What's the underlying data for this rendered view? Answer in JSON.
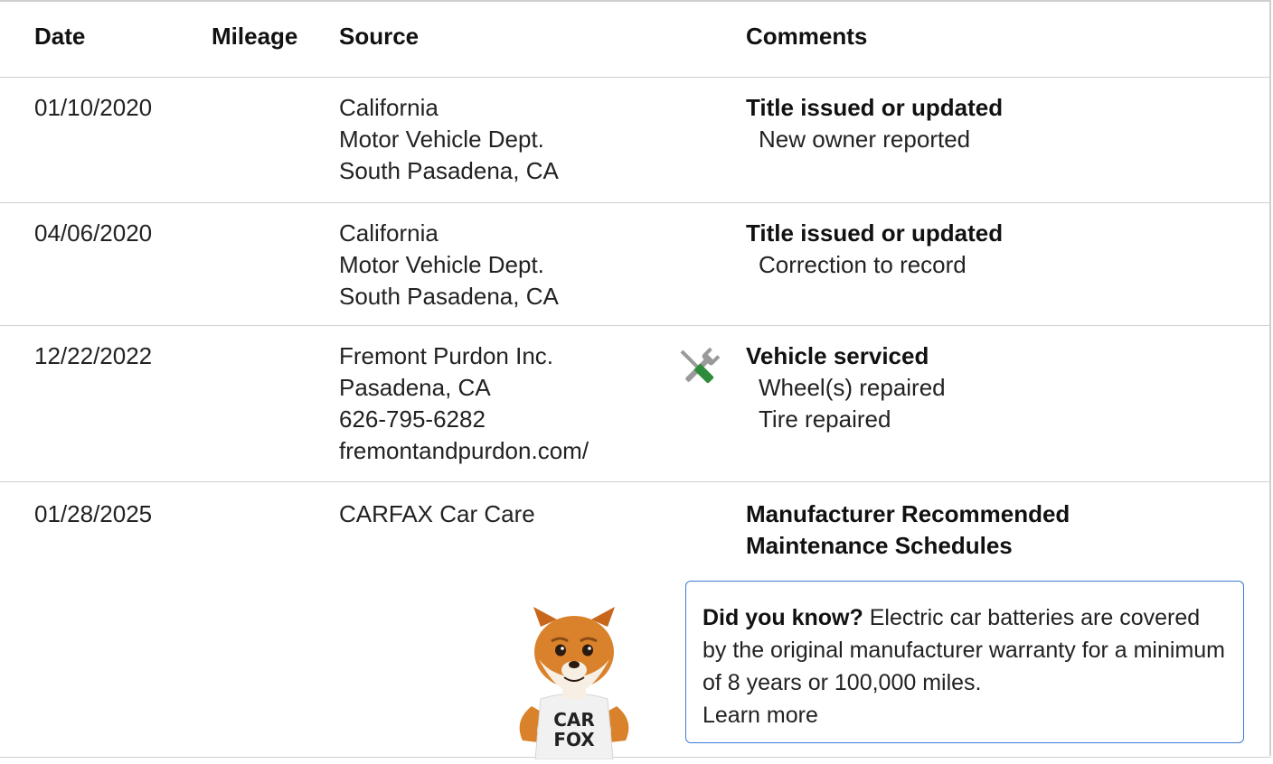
{
  "table": {
    "headers": {
      "date": "Date",
      "mileage": "Mileage",
      "source": "Source",
      "comments": "Comments"
    },
    "rows": [
      {
        "date": "01/10/2020",
        "mileage": "",
        "source": [
          "California",
          "Motor Vehicle Dept.",
          "South Pasadena, CA"
        ],
        "comment_title": "Title issued or updated",
        "comment_details": [
          "New owner reported"
        ]
      },
      {
        "date": "04/06/2020",
        "mileage": "",
        "source": [
          "California",
          "Motor Vehicle Dept.",
          "South Pasadena, CA"
        ],
        "comment_title": "Title issued or updated",
        "comment_details": [
          "Correction to record"
        ]
      },
      {
        "date": "12/22/2022",
        "mileage": "",
        "source": [
          "Fremont Purdon Inc.",
          "Pasadena, CA",
          "626-795-6282",
          "fremontandpurdon.com/"
        ],
        "icon": "wrench-screwdriver-icon",
        "comment_title": "Vehicle serviced",
        "comment_details": [
          "Wheel(s) repaired",
          "Tire repaired"
        ]
      },
      {
        "date": "01/28/2025",
        "mileage": "",
        "source": [
          "CARFAX Car Care"
        ],
        "comment_title_lines": [
          "Manufacturer Recommended",
          "Maintenance Schedules"
        ]
      }
    ]
  },
  "tip": {
    "lead": "Did you know?",
    "text": " Electric car batteries are covered by the original manufacturer warranty for a minimum of 8 years or 100,000 miles.",
    "link": "Learn more",
    "border_color": "#3a7bd5"
  },
  "mascot": {
    "icon": "carfox-mascot",
    "shirt_line1": "CAR",
    "shirt_line2": "FOX"
  },
  "colors": {
    "divider": "#cfcfcf",
    "wrench_handle": "#2e8b3a",
    "tool_gray": "#9a9a9a"
  }
}
